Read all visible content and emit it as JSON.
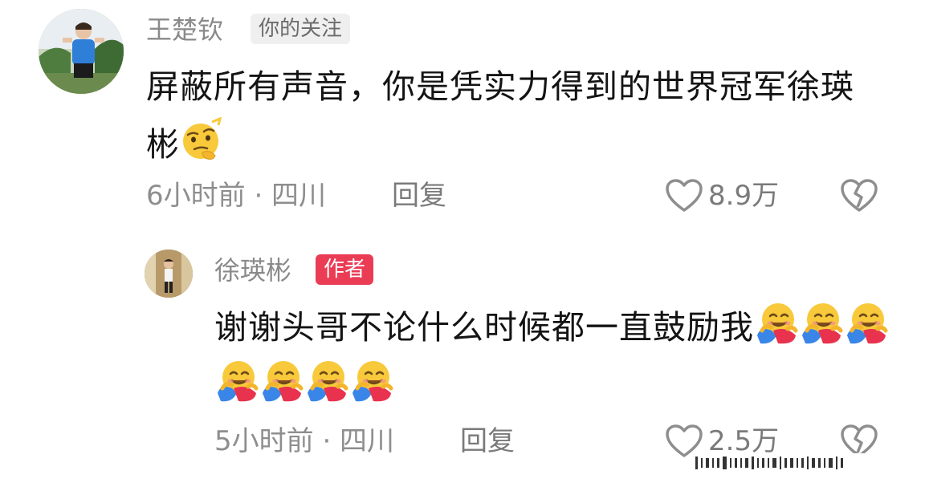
{
  "comments": [
    {
      "username": "王楚钦",
      "badge": "你的关注",
      "text": "屏蔽所有声音，你是凭实力得到的世界冠军徐瑛彬",
      "time_location": "6小时前 · 四川",
      "reply_label": "回复",
      "likes": "8.9万",
      "emoji": "thinking-smirk-emoji"
    },
    {
      "username": "徐瑛彬",
      "badge": "作者",
      "text": "谢谢头哥不论什么时候都一直鼓励我",
      "time_location": "5小时前 · 四川",
      "reply_label": "回复",
      "likes": "2.5万",
      "emoji": "hugging-face-emoji",
      "emoji_count": 7
    }
  ],
  "icons": {
    "like": "heart-outline-icon",
    "dislike": "broken-heart-icon"
  },
  "colors": {
    "author_badge": "#ea3c55",
    "follow_badge_bg": "#efefef",
    "meta_text": "#8e8e8e"
  }
}
